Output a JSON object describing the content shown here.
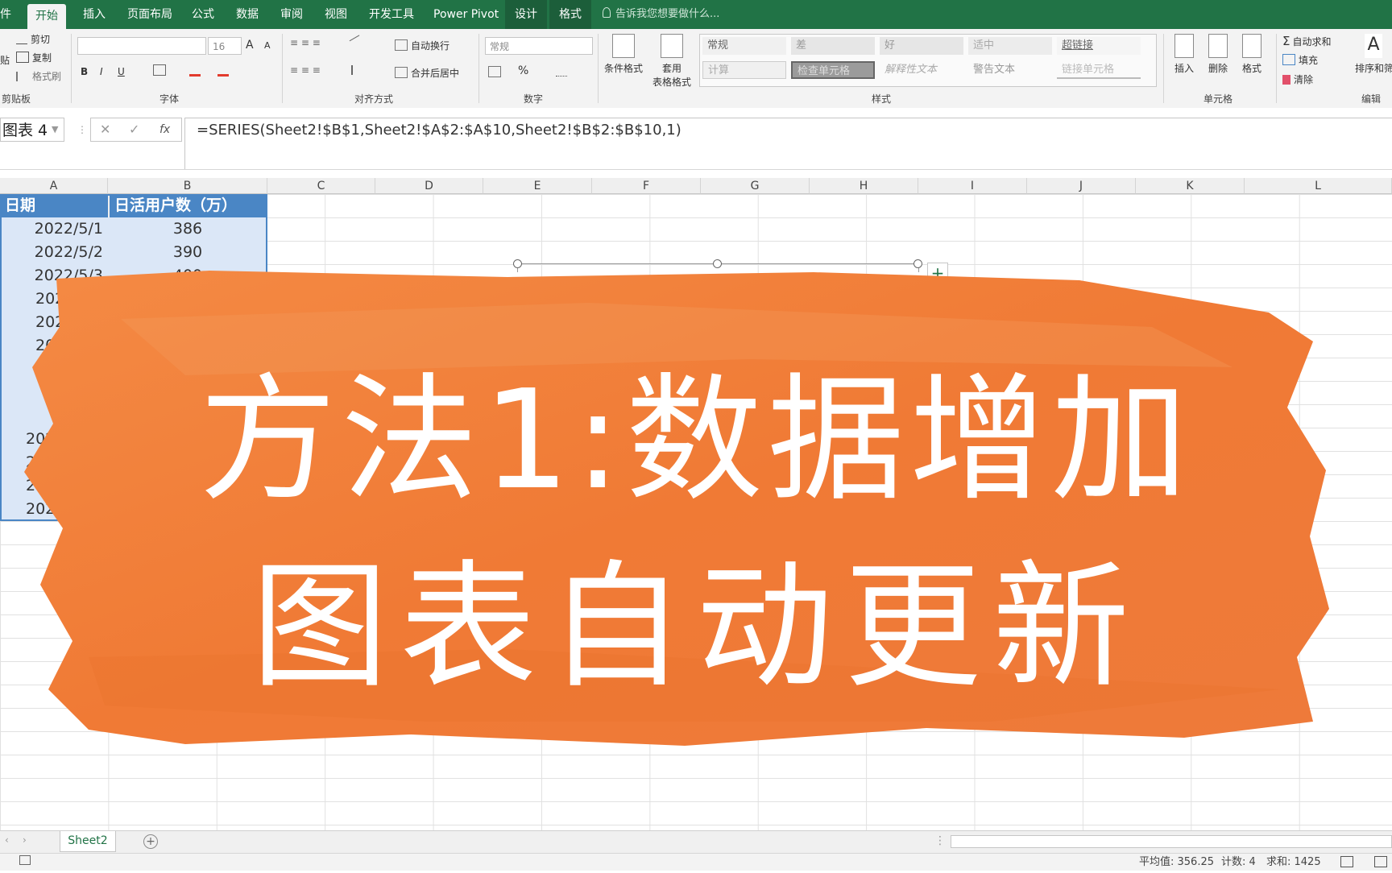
{
  "ribbon": {
    "tabs": [
      "件",
      "开始",
      "插入",
      "页面布局",
      "公式",
      "数据",
      "审阅",
      "视图",
      "开发工具",
      "Power Pivot",
      "设计",
      "格式"
    ],
    "tell_me": "告诉我您想要做什么...",
    "clipboard": {
      "cut": "剪切",
      "copy": "复制",
      "format_painter": "格式刷",
      "label": "剪贴板",
      "paste": "贴"
    },
    "font": {
      "name": "",
      "size": "16",
      "label": "字体",
      "bold": "B",
      "italic": "I",
      "underline": "U",
      "grow": "A",
      "shrink": "A"
    },
    "alignment": {
      "wrap": "自动换行",
      "merge": "合并后居中",
      "label": "对齐方式"
    },
    "number": {
      "format": "常规",
      "percent": "%",
      "label": "数字"
    },
    "styles": {
      "conditional": "条件格式",
      "table_format_1": "套用",
      "table_format_2": "表格格式",
      "cells": [
        "常规",
        "差",
        "好",
        "适中",
        "超链接",
        "计算",
        "检查单元格",
        "解释性文本",
        "警告文本",
        "链接单元格"
      ],
      "label": "样式"
    },
    "cells": {
      "insert": "插入",
      "delete": "删除",
      "format": "格式",
      "label": "单元格"
    },
    "editing": {
      "autosum": "自动求和",
      "fill": "填充",
      "clear": "清除",
      "sort": "排序和筛",
      "label": "编辑"
    }
  },
  "formula_bar": {
    "name_box": "图表 4",
    "formula": "=SERIES(Sheet2!$B$1,Sheet2!$A$2:$A$10,Sheet2!$B$2:$B$10,1)"
  },
  "grid": {
    "columns": [
      "A",
      "B",
      "C",
      "D",
      "E",
      "F",
      "G",
      "H",
      "I",
      "J",
      "K",
      "L"
    ],
    "header": [
      "日期",
      "日活用户数（万）"
    ],
    "rows": [
      [
        "2022/5/1",
        "386"
      ],
      [
        "2022/5/2",
        "390"
      ],
      [
        "2022/5/3",
        "400"
      ]
    ],
    "partial_dates": [
      "202",
      "202",
      "202",
      "202",
      "202",
      "202",
      "2022"
    ]
  },
  "overlay": {
    "line1": "方法1:数据增加",
    "line2": "图表自动更新"
  },
  "sheets": {
    "tabs": [
      "Sheet2"
    ]
  },
  "status": {
    "average": "平均值: 356.25",
    "count": "计数: 4",
    "sum": "求和: 1425"
  },
  "colors": {
    "excel_green": "#217346",
    "header_blue": "#4a86c5",
    "selection_blue": "#dbe7f7",
    "banner_orange": "#f07a35"
  }
}
